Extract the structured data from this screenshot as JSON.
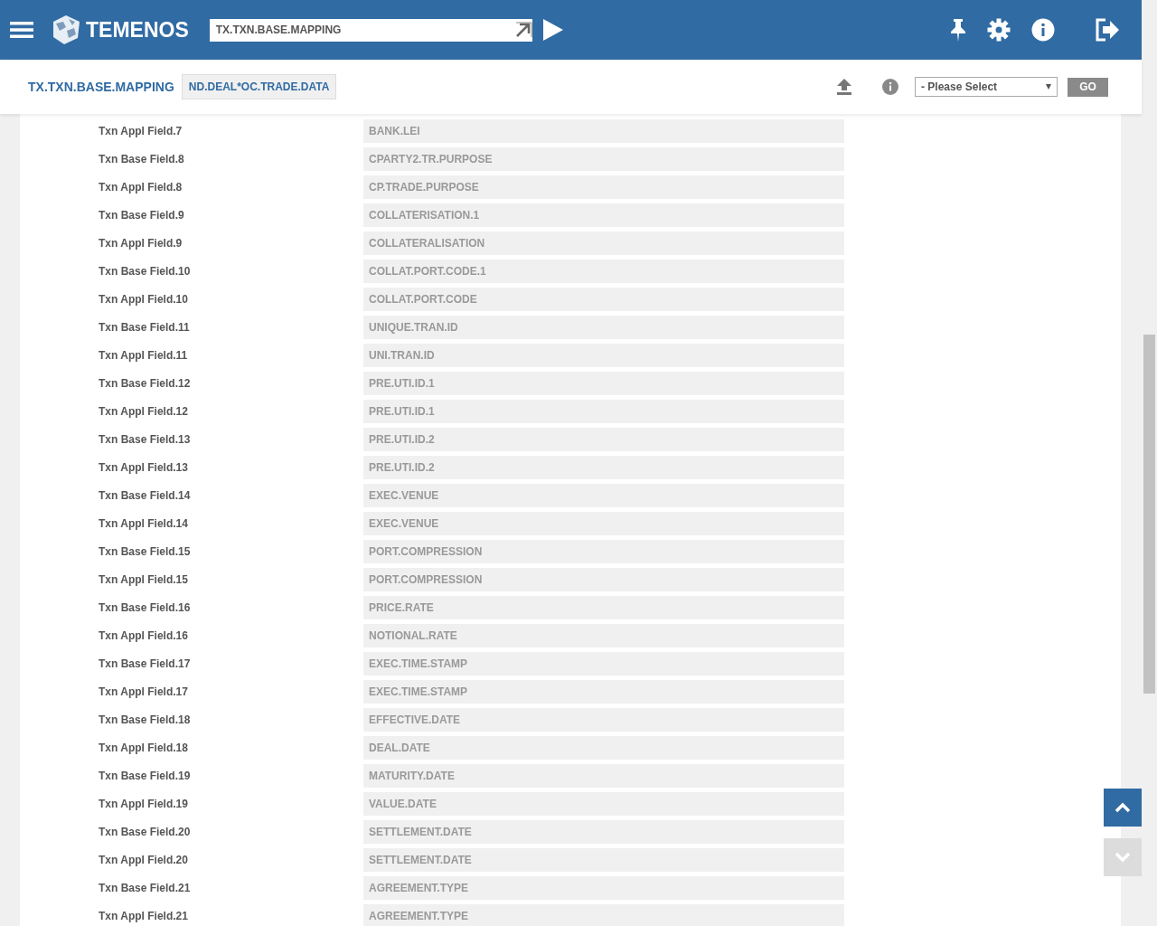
{
  "header": {
    "brand": "TEMENOS",
    "command": {
      "value": "TX.TXN.BASE.MAPPING"
    }
  },
  "toolbar": {
    "title": "TX.TXN.BASE.MAPPING",
    "record_id": "ND.DEAL*OC.TRADE.DATA",
    "select": {
      "value": "- Please Select"
    },
    "go_button": "GO"
  },
  "rows": [
    {
      "label": "Txn Appl Field.7",
      "value": "BANK.LEI"
    },
    {
      "label": "Txn Base Field.8",
      "value": "CPARTY2.TR.PURPOSE"
    },
    {
      "label": "Txn Appl Field.8",
      "value": "CP.TRADE.PURPOSE"
    },
    {
      "label": "Txn Base Field.9",
      "value": "COLLATERISATION.1"
    },
    {
      "label": "Txn Appl Field.9",
      "value": "COLLATERALISATION"
    },
    {
      "label": "Txn Base Field.10",
      "value": "COLLAT.PORT.CODE.1"
    },
    {
      "label": "Txn Appl Field.10",
      "value": "COLLAT.PORT.CODE"
    },
    {
      "label": "Txn Base Field.11",
      "value": "UNIQUE.TRAN.ID"
    },
    {
      "label": "Txn Appl Field.11",
      "value": "UNI.TRAN.ID"
    },
    {
      "label": "Txn Base Field.12",
      "value": "PRE.UTI.ID.1"
    },
    {
      "label": "Txn Appl Field.12",
      "value": "PRE.UTI.ID.1"
    },
    {
      "label": "Txn Base Field.13",
      "value": "PRE.UTI.ID.2"
    },
    {
      "label": "Txn Appl Field.13",
      "value": "PRE.UTI.ID.2"
    },
    {
      "label": "Txn Base Field.14",
      "value": "EXEC.VENUE"
    },
    {
      "label": "Txn Appl Field.14",
      "value": "EXEC.VENUE"
    },
    {
      "label": "Txn Base Field.15",
      "value": "PORT.COMPRESSION"
    },
    {
      "label": "Txn Appl Field.15",
      "value": "PORT.COMPRESSION"
    },
    {
      "label": "Txn Base Field.16",
      "value": "PRICE.RATE"
    },
    {
      "label": "Txn Appl Field.16",
      "value": "NOTIONAL.RATE"
    },
    {
      "label": "Txn Base Field.17",
      "value": "EXEC.TIME.STAMP"
    },
    {
      "label": "Txn Appl Field.17",
      "value": "EXEC.TIME.STAMP"
    },
    {
      "label": "Txn Base Field.18",
      "value": "EFFECTIVE.DATE"
    },
    {
      "label": "Txn Appl Field.18",
      "value": "DEAL.DATE"
    },
    {
      "label": "Txn Base Field.19",
      "value": "MATURITY.DATE"
    },
    {
      "label": "Txn Appl Field.19",
      "value": "VALUE.DATE"
    },
    {
      "label": "Txn Base Field.20",
      "value": "SETTLEMENT.DATE"
    },
    {
      "label": "Txn Appl Field.20",
      "value": "SETTLEMENT.DATE"
    },
    {
      "label": "Txn Base Field.21",
      "value": "AGREEMENT.TYPE"
    },
    {
      "label": "Txn Appl Field.21",
      "value": "AGREEMENT.TYPE"
    }
  ],
  "scroll_buttons": [
    {
      "kind": "up",
      "disabled": false
    },
    {
      "kind": "down",
      "disabled": true
    }
  ]
}
